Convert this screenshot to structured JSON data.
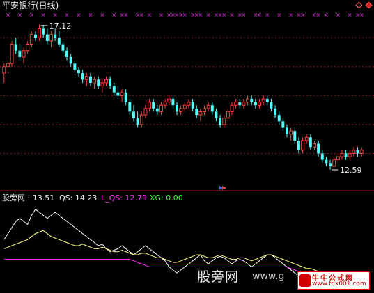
{
  "header": {
    "title": "平安银行(日线)"
  },
  "colors": {
    "up": "#ff3c3c",
    "down": "#54ffff",
    "grid": "#8b1a1a",
    "divider": "#b81010",
    "markers": "#ff33ff",
    "ind_white": "#ffffff",
    "ind_yellow": "#ffff80",
    "ind_magenta": "#ff33ff",
    "ind_green": "#33ff33"
  },
  "chart_data": [
    {
      "type": "candlestick",
      "title": "平安银行(日线)",
      "ylim": [
        12.2,
        17.4
      ],
      "annotations": {
        "high": "17.12",
        "low": "12.59"
      },
      "top_marker_symbol": "×",
      "grid": true,
      "ohlc": [
        [
          15.6,
          15.9,
          15.3,
          15.8
        ],
        [
          15.8,
          16.1,
          15.6,
          15.9
        ],
        [
          15.9,
          16.6,
          15.8,
          16.5
        ],
        [
          16.5,
          16.7,
          16.2,
          16.3
        ],
        [
          16.3,
          16.5,
          16.0,
          16.1
        ],
        [
          16.1,
          16.4,
          15.9,
          16.3
        ],
        [
          16.3,
          16.6,
          16.2,
          16.5
        ],
        [
          16.5,
          16.9,
          16.4,
          16.8
        ],
        [
          16.8,
          16.9,
          16.6,
          16.7
        ],
        [
          16.7,
          17.12,
          16.6,
          17.0
        ],
        [
          17.0,
          17.1,
          16.7,
          16.8
        ],
        [
          16.8,
          17.0,
          16.5,
          16.6
        ],
        [
          16.6,
          16.9,
          16.4,
          16.8
        ],
        [
          16.8,
          17.0,
          16.6,
          16.7
        ],
        [
          16.7,
          16.9,
          16.4,
          16.5
        ],
        [
          16.5,
          16.6,
          16.2,
          16.3
        ],
        [
          16.3,
          16.4,
          16.0,
          16.1
        ],
        [
          16.1,
          16.2,
          15.8,
          15.9
        ],
        [
          15.9,
          16.0,
          15.6,
          15.7
        ],
        [
          15.7,
          15.8,
          15.5,
          15.6
        ],
        [
          15.6,
          15.7,
          15.3,
          15.4
        ],
        [
          15.4,
          15.6,
          15.2,
          15.5
        ],
        [
          15.5,
          15.6,
          15.2,
          15.3
        ],
        [
          15.3,
          15.5,
          15.1,
          15.4
        ],
        [
          15.4,
          15.5,
          15.1,
          15.2
        ],
        [
          15.2,
          15.4,
          15.0,
          15.3
        ],
        [
          15.3,
          15.5,
          15.2,
          15.4
        ],
        [
          15.4,
          15.5,
          15.1,
          15.2
        ],
        [
          15.2,
          15.3,
          14.9,
          15.0
        ],
        [
          15.0,
          15.2,
          14.8,
          14.9
        ],
        [
          14.9,
          15.1,
          14.7,
          15.0
        ],
        [
          15.0,
          15.1,
          14.6,
          14.7
        ],
        [
          14.7,
          14.8,
          14.3,
          14.4
        ],
        [
          14.4,
          14.6,
          14.1,
          14.2
        ],
        [
          14.2,
          14.4,
          13.9,
          14.0
        ],
        [
          14.0,
          14.4,
          13.9,
          14.3
        ],
        [
          14.3,
          14.6,
          14.2,
          14.5
        ],
        [
          14.5,
          14.8,
          14.4,
          14.7
        ],
        [
          14.7,
          14.8,
          14.4,
          14.5
        ],
        [
          14.5,
          14.6,
          14.3,
          14.4
        ],
        [
          14.4,
          14.7,
          14.3,
          14.6
        ],
        [
          14.6,
          14.8,
          14.5,
          14.7
        ],
        [
          14.7,
          14.9,
          14.6,
          14.8
        ],
        [
          14.8,
          14.9,
          14.5,
          14.6
        ],
        [
          14.6,
          14.7,
          14.3,
          14.4
        ],
        [
          14.4,
          14.6,
          14.3,
          14.5
        ],
        [
          14.5,
          14.7,
          14.4,
          14.6
        ],
        [
          14.6,
          14.8,
          14.5,
          14.7
        ],
        [
          14.7,
          14.8,
          14.4,
          14.5
        ],
        [
          14.5,
          14.6,
          14.2,
          14.3
        ],
        [
          14.3,
          14.5,
          14.1,
          14.4
        ],
        [
          14.4,
          14.6,
          14.3,
          14.5
        ],
        [
          14.5,
          14.7,
          14.4,
          14.6
        ],
        [
          14.6,
          14.7,
          14.3,
          14.4
        ],
        [
          14.4,
          14.5,
          14.1,
          14.2
        ],
        [
          14.2,
          14.3,
          13.9,
          14.0
        ],
        [
          14.0,
          14.3,
          13.9,
          14.2
        ],
        [
          14.2,
          14.5,
          14.1,
          14.4
        ],
        [
          14.4,
          14.7,
          14.3,
          14.6
        ],
        [
          14.6,
          14.8,
          14.5,
          14.7
        ],
        [
          14.7,
          14.8,
          14.5,
          14.6
        ],
        [
          14.6,
          14.8,
          14.5,
          14.7
        ],
        [
          14.7,
          14.9,
          14.6,
          14.8
        ],
        [
          14.8,
          14.9,
          14.6,
          14.7
        ],
        [
          14.7,
          14.8,
          14.5,
          14.6
        ],
        [
          14.6,
          14.8,
          14.5,
          14.7
        ],
        [
          14.7,
          14.9,
          14.6,
          14.8
        ],
        [
          14.8,
          14.9,
          14.6,
          14.7
        ],
        [
          14.7,
          14.8,
          14.4,
          14.5
        ],
        [
          14.5,
          14.6,
          14.2,
          14.3
        ],
        [
          14.3,
          14.4,
          14.0,
          14.1
        ],
        [
          14.1,
          14.2,
          13.8,
          13.9
        ],
        [
          13.9,
          14.0,
          13.6,
          13.7
        ],
        [
          13.7,
          13.9,
          13.5,
          13.8
        ],
        [
          13.8,
          13.9,
          13.4,
          13.5
        ],
        [
          13.5,
          13.6,
          13.1,
          13.2
        ],
        [
          13.2,
          13.6,
          13.1,
          13.5
        ],
        [
          13.5,
          13.7,
          13.4,
          13.6
        ],
        [
          13.6,
          13.7,
          13.2,
          13.3
        ],
        [
          13.3,
          13.5,
          13.2,
          13.4
        ],
        [
          13.4,
          13.5,
          13.0,
          13.1
        ],
        [
          13.1,
          13.2,
          12.8,
          12.9
        ],
        [
          12.9,
          13.0,
          12.7,
          12.8
        ],
        [
          12.8,
          12.9,
          12.59,
          12.7
        ],
        [
          12.7,
          13.0,
          12.6,
          12.9
        ],
        [
          12.9,
          13.1,
          12.8,
          13.0
        ],
        [
          13.0,
          13.2,
          12.9,
          13.1
        ],
        [
          13.1,
          13.2,
          12.9,
          13.0
        ],
        [
          13.0,
          13.2,
          12.9,
          13.1
        ],
        [
          13.1,
          13.3,
          13.0,
          13.2
        ],
        [
          13.2,
          13.3,
          13.0,
          13.1
        ],
        [
          13.1,
          13.3,
          13.0,
          13.2
        ]
      ]
    },
    {
      "type": "line",
      "title": "股旁网",
      "ylim": [
        -2,
        26
      ],
      "legend": [
        {
          "name": "股旁网",
          "value": "13.51",
          "color": "#e8e8e8"
        },
        {
          "name": "QS",
          "value": "14.23",
          "color": "#e8e8e8"
        },
        {
          "name": "L_QS",
          "value": "12.79",
          "color": "#ff33ff"
        },
        {
          "name": "XG",
          "value": "0.00",
          "color": "#33ff33"
        }
      ],
      "series": [
        {
          "name": "股旁网",
          "color": "#ffffff",
          "values": [
            14,
            16,
            18,
            20,
            21,
            20,
            19,
            22,
            24,
            23,
            22,
            21,
            22,
            23,
            22,
            21,
            20,
            19,
            18,
            17,
            16,
            15,
            14,
            13,
            12,
            12.5,
            11,
            10,
            10.5,
            11,
            12,
            11,
            10,
            9,
            10,
            11,
            12,
            11,
            10,
            9,
            8,
            7,
            5,
            4,
            3,
            4,
            5,
            6,
            7,
            8,
            9,
            7,
            6,
            7,
            8,
            8.5,
            8,
            7,
            6,
            7,
            7.5,
            7,
            6,
            5,
            6,
            7,
            8,
            9,
            9,
            8,
            7,
            6,
            5,
            4,
            3,
            2,
            1,
            0.5,
            1,
            2,
            2.5,
            2,
            1,
            0,
            -0.5,
            0,
            0.5,
            0,
            -1,
            -0.5,
            0,
            0
          ]
        },
        {
          "name": "QS",
          "color": "#ffff80",
          "values": [
            11,
            11.5,
            12,
            12.5,
            13,
            13.5,
            14,
            15,
            16,
            16.5,
            17,
            16,
            15,
            14.5,
            14,
            13.5,
            13,
            12.5,
            12,
            12,
            12.5,
            12,
            11.5,
            11,
            11,
            11.5,
            11,
            10.5,
            10,
            10,
            10.5,
            10,
            9.5,
            9,
            9,
            9.5,
            9.5,
            9,
            8.5,
            8,
            8,
            7.5,
            7,
            6.5,
            6.5,
            7,
            7.5,
            8,
            8.5,
            9,
            9,
            8.5,
            8,
            8,
            8.5,
            9,
            8.5,
            8,
            7.5,
            7.5,
            8,
            8,
            7.5,
            7,
            7.5,
            8,
            8.5,
            9,
            9,
            8.5,
            8,
            7.5,
            7,
            6.5,
            6,
            5.5,
            5,
            4.5,
            4.5,
            4,
            3.5,
            3,
            2.5,
            2,
            1.5,
            1,
            0.5,
            0,
            -0.5,
            0,
            0.5,
            1
          ]
        },
        {
          "name": "L_QS",
          "color": "#ff33ff",
          "values": [
            7.5,
            7.5,
            7.5,
            7.5,
            7.5,
            7.5,
            7.5,
            7.5,
            7.5,
            7.5,
            7.5,
            7.5,
            7.5,
            7.5,
            7.5,
            7.5,
            7.5,
            7.5,
            7.5,
            7.5,
            7.5,
            7.5,
            7.5,
            7.5,
            7.5,
            7.5,
            7.5,
            7.5,
            7.5,
            7.5,
            7.5,
            7.5,
            7.5,
            7,
            6.5,
            6,
            5.5,
            5,
            5,
            5,
            5,
            5,
            5,
            5,
            5,
            5,
            5,
            5,
            5,
            5,
            5,
            5,
            5,
            5,
            5,
            5,
            5,
            5,
            5,
            5,
            5,
            5,
            5,
            5,
            5,
            5,
            5,
            5,
            5,
            5,
            5,
            5,
            5,
            4.5,
            4,
            3.5,
            3,
            2.5,
            2,
            1.5,
            1.5,
            1.5,
            1.5,
            1.5,
            1.5,
            1,
            0.5,
            0,
            0,
            0,
            0,
            0
          ]
        }
      ]
    }
  ],
  "watermark": {
    "site_name": "股旁网",
    "url_partial": "www.g",
    "stamp_title": "牛牛公式网",
    "stamp_url": "www.fdx001.com"
  }
}
